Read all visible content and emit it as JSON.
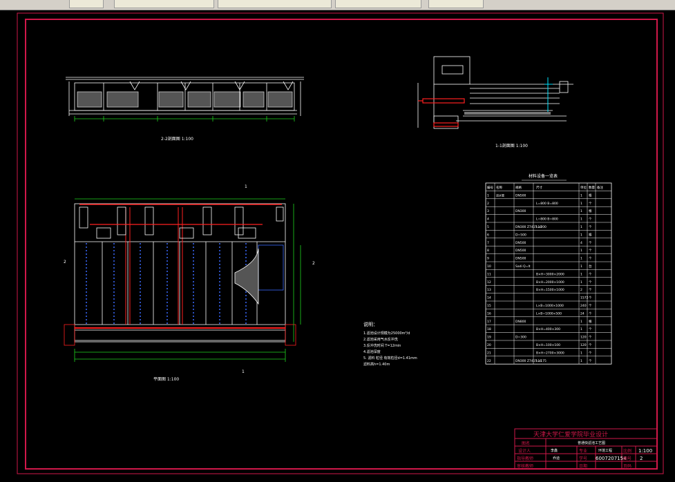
{
  "toolbar": {
    "tabs": [
      "",
      "",
      "",
      ""
    ],
    "search_placeholder": ""
  },
  "drawing": {
    "section_2_2": "2-2剖面图 1:100",
    "section_1_1": "1-1剖面图 1:100",
    "plan": "平面图 1:100",
    "marker_1": "1",
    "marker_2": "2",
    "table_title": "材料设备一览表",
    "table_headers": [
      "编号",
      "名称",
      "规格",
      "尺寸",
      "单位",
      "数量",
      "备注"
    ],
    "table_rows": [
      [
        "1",
        "进水管",
        "DN500",
        "",
        "1",
        "根",
        ""
      ],
      [
        "2",
        "",
        "",
        "L=800 B=800",
        "1",
        "个",
        ""
      ],
      [
        "3",
        "",
        "DN300",
        "",
        "1",
        "根",
        ""
      ],
      [
        "4",
        "",
        "",
        "L=800 B=800",
        "1",
        "个",
        ""
      ],
      [
        "5",
        "",
        "DN300 Z741T-10",
        "L=200",
        "1",
        "个",
        ""
      ],
      [
        "6",
        "",
        "D=500",
        "",
        "1",
        "根",
        ""
      ],
      [
        "7",
        "",
        "DN500",
        "",
        "4",
        "个",
        ""
      ],
      [
        "8",
        "",
        "DN500",
        "",
        "1",
        "个",
        ""
      ],
      [
        "9",
        "",
        "DN500",
        "",
        "1",
        "个",
        ""
      ],
      [
        "10",
        "",
        "Sadi Q=It",
        "",
        "1",
        "台",
        ""
      ],
      [
        "11",
        "",
        "",
        "B×H=3000×2000",
        "1",
        "个",
        ""
      ],
      [
        "12",
        "",
        "",
        "B×H=2000×1000",
        "1",
        "个",
        ""
      ],
      [
        "13",
        "",
        "",
        "B×H=1500×1000",
        "2",
        "个",
        ""
      ],
      [
        "14",
        "",
        "",
        "",
        "1572",
        "个",
        ""
      ],
      [
        "15",
        "",
        "",
        "L×B=1000×1000",
        "240",
        "个",
        ""
      ],
      [
        "16",
        "",
        "",
        "L×B=1000×500",
        "24",
        "个",
        ""
      ],
      [
        "17",
        "",
        "DN800",
        "",
        "1",
        "根",
        ""
      ],
      [
        "18",
        "",
        "",
        "B×H=400×300",
        "1",
        "个",
        ""
      ],
      [
        "19",
        "",
        "D=300",
        "",
        "120",
        "个",
        ""
      ],
      [
        "20",
        "",
        "",
        "B×H=100×100",
        "120",
        "个",
        ""
      ],
      [
        "21",
        "",
        "",
        "B×H=2700×3000",
        "1",
        "个",
        ""
      ],
      [
        "22",
        "",
        "DN300 Z741T-10",
        "L=175",
        "1",
        "个",
        ""
      ]
    ],
    "notes_title": "说明：",
    "notes": [
      "1.滤池设计规模为25000m³/d",
      "2.滤池采用气水反冲洗",
      "3.反冲洗时间 T=12min",
      "4.滤池深度",
      "5. 滤料    粒径 有效粒径d=1.41mm",
      "   滤料高h=1.40m"
    ],
    "title_block": {
      "school": "天津大学仁爱学院毕业设计",
      "drawing_name": "普通快滤池工艺图",
      "row1": [
        "图名",
        ""
      ],
      "row2": [
        "设计人",
        "李鑫",
        "专业",
        "环境工程",
        "比例",
        "1:100"
      ],
      "row3": [
        "指导教师",
        "乔迪",
        "学号",
        "6007207154",
        "图号",
        "2"
      ],
      "row4": [
        "审核教师",
        "",
        "日期",
        "",
        "页码",
        ""
      ],
      "scale": "1:100",
      "sheet_no": "2",
      "student_id": "6007207154"
    }
  },
  "colors": {
    "background": "#000000",
    "frame": "#d1184a",
    "line": "#ffffff",
    "green": "#1fd51f",
    "red": "#ff2020",
    "blue": "#3a6bff",
    "cyan": "#00e5ff",
    "magenta": "#ff00ff"
  }
}
